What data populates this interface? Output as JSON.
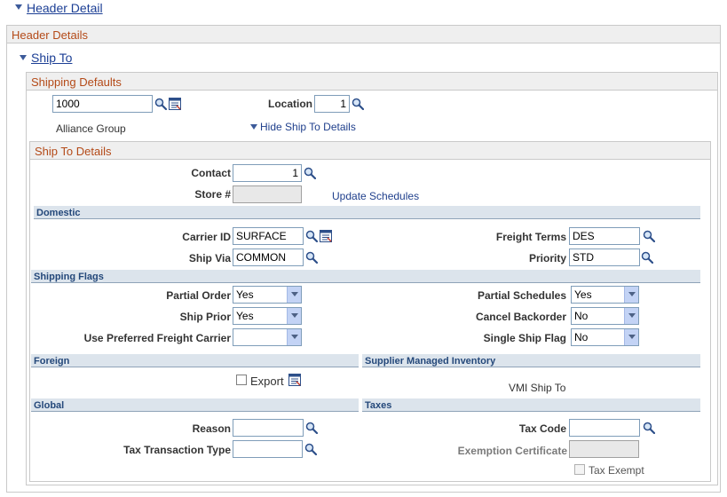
{
  "header_detail": {
    "title": "Header Detail"
  },
  "header_details": {
    "title": "Header Details"
  },
  "ship_to": {
    "title": "Ship To"
  },
  "shipping_defaults": {
    "title": "Shipping Defaults",
    "ship_to_value": "1000",
    "ship_to_desc": "Alliance Group",
    "location_label": "Location",
    "location_value": "1",
    "hide_link": "Hide Ship To Details"
  },
  "ship_to_details": {
    "title": "Ship To Details",
    "contact_label": "Contact",
    "contact_value": "1",
    "store_label": "Store #",
    "store_value": "",
    "update_schedules": "Update Schedules"
  },
  "domestic": {
    "title": "Domestic",
    "carrier_label": "Carrier ID",
    "carrier_value": "SURFACE",
    "ship_via_label": "Ship Via",
    "ship_via_value": "COMMON",
    "freight_terms_label": "Freight Terms",
    "freight_terms_value": "DES",
    "priority_label": "Priority",
    "priority_value": "STD"
  },
  "shipping_flags": {
    "title": "Shipping Flags",
    "partial_order_label": "Partial Order",
    "partial_order_value": "Yes",
    "ship_prior_label": "Ship Prior",
    "ship_prior_value": "Yes",
    "preferred_freight_label": "Use Preferred Freight Carrier",
    "preferred_freight_value": "",
    "partial_schedules_label": "Partial Schedules",
    "partial_schedules_value": "Yes",
    "cancel_backorder_label": "Cancel Backorder",
    "cancel_backorder_value": "No",
    "single_ship_label": "Single Ship Flag",
    "single_ship_value": "No"
  },
  "foreign": {
    "title": "Foreign",
    "export_label": "Export"
  },
  "smi": {
    "title": "Supplier Managed Inventory",
    "vmi_label": "VMI Ship To"
  },
  "global": {
    "title": "Global",
    "reason_label": "Reason",
    "reason_value": "",
    "tax_txn_label": "Tax Transaction Type",
    "tax_txn_value": ""
  },
  "taxes": {
    "title": "Taxes",
    "tax_code_label": "Tax Code",
    "tax_code_value": "",
    "exemption_label": "Exemption Certificate",
    "exemption_value": "",
    "tax_exempt_label": "Tax Exempt"
  },
  "colors": {
    "link": "#1c3f95",
    "section_title": "#b44a18",
    "bar_bg": "#dce4ec",
    "bar_text": "#24487a"
  }
}
